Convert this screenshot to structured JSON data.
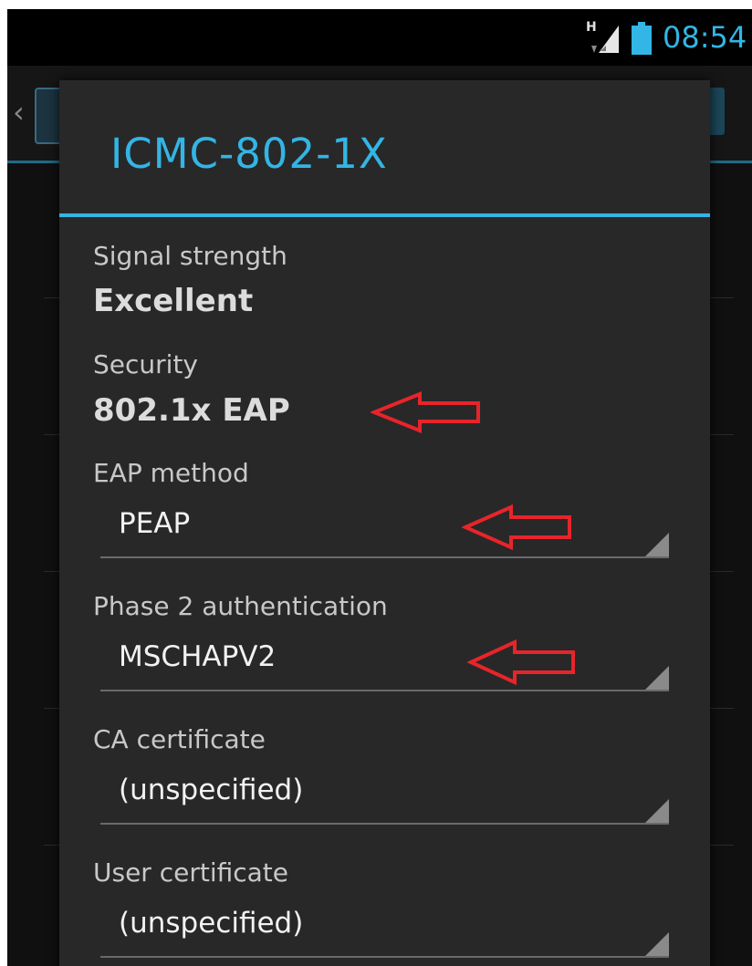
{
  "status_bar": {
    "network_type": "H",
    "time": "08:54",
    "accent_color": "#33b5e5"
  },
  "dialog": {
    "title": "ICMC-802-1X",
    "signal": {
      "label": "Signal strength",
      "value": "Excellent"
    },
    "security": {
      "label": "Security",
      "value": "802.1x EAP"
    },
    "eap_method": {
      "label": "EAP method",
      "selected": "PEAP"
    },
    "phase2": {
      "label": "Phase 2 authentication",
      "selected": "MSCHAPV2"
    },
    "ca_cert": {
      "label": "CA certificate",
      "selected": "(unspecified)"
    },
    "user_cert": {
      "label": "User certificate",
      "selected": "(unspecified)"
    }
  },
  "annotations": {
    "arrow_color": "#e8242b",
    "arrow_icon": "left-arrow-outline"
  }
}
